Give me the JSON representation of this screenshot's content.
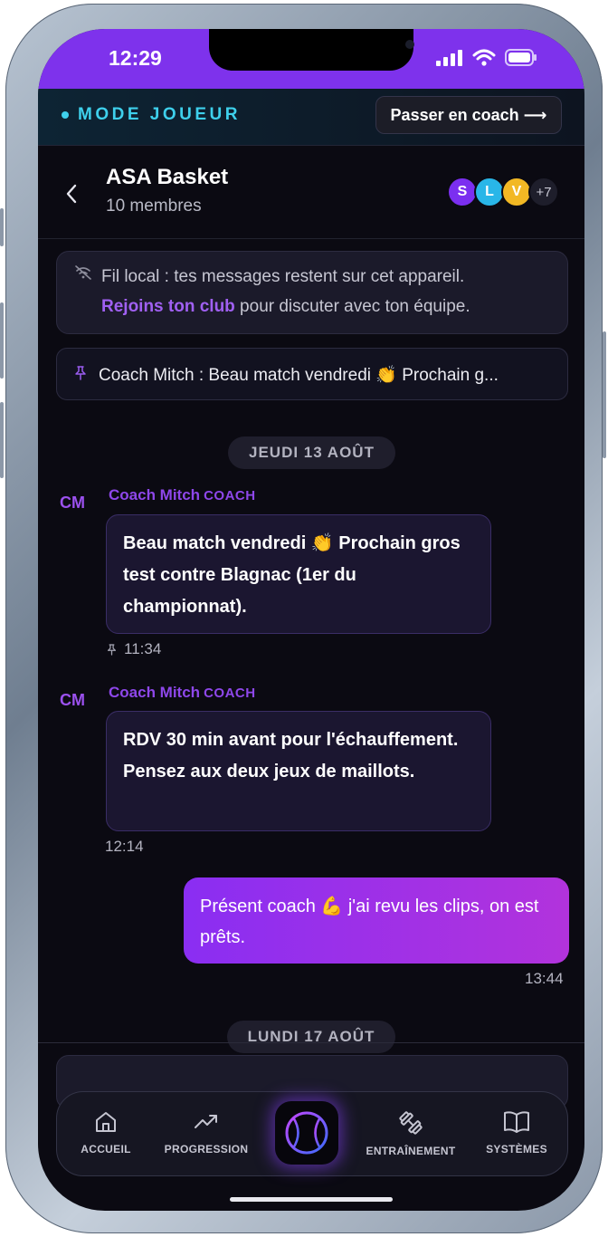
{
  "status_bar": {
    "time": "12:29"
  },
  "mode_bar": {
    "label": "MODE JOUEUR",
    "switch_button": "Passer en coach ⟶"
  },
  "header": {
    "title": "ASA Basket",
    "subtitle": "10 membres",
    "avatars": [
      {
        "initial": "S",
        "color": "#7b2ff0"
      },
      {
        "initial": "L",
        "color": "#29b6e8"
      },
      {
        "initial": "V",
        "color": "#f2b824"
      }
    ],
    "more_count": "+7"
  },
  "notice": {
    "line1": "Fil local : tes messages restent sur cet appareil.",
    "link": "Rejoins ton club",
    "line2_rest": " pour discuter avec ton équipe."
  },
  "pinned": {
    "text": "Coach Mitch : Beau match vendredi 👏 Prochain g..."
  },
  "date_separators": [
    "JEUDI 13 AOÛT",
    "LUNDI 17 AOÛT"
  ],
  "messages": [
    {
      "initials": "CM",
      "sender": "Coach Mitch",
      "role": "COACH",
      "text": "Beau match vendredi 👏 Prochain gros test contre Blagnac (1er du championnat).",
      "time": "11:34",
      "pinned": true
    },
    {
      "initials": "CM",
      "sender": "Coach Mitch",
      "role": "COACH",
      "text": "RDV 30 min avant pour l'échauffement. Pensez aux deux jeux de maillots.",
      "time": "12:14",
      "pinned": false
    },
    {
      "outgoing": true,
      "text": "Présent coach 💪 j'ai revu les clips, on est prêts.",
      "time": "13:44"
    }
  ],
  "tab_bar": {
    "tabs": [
      {
        "label": "ACCUEIL",
        "icon": "home-icon"
      },
      {
        "label": "PROGRESSION",
        "icon": "trending-up-icon"
      },
      {
        "label": "ENTRAÎNEMENT",
        "icon": "dumbbell-icon"
      },
      {
        "label": "SYSTÈMES",
        "icon": "book-icon"
      }
    ],
    "center_icon": "basketball-icon"
  },
  "colors": {
    "accent_purple": "#7e32ec",
    "mode_cyan": "#3ed0ec",
    "background": "#0b0a12"
  }
}
